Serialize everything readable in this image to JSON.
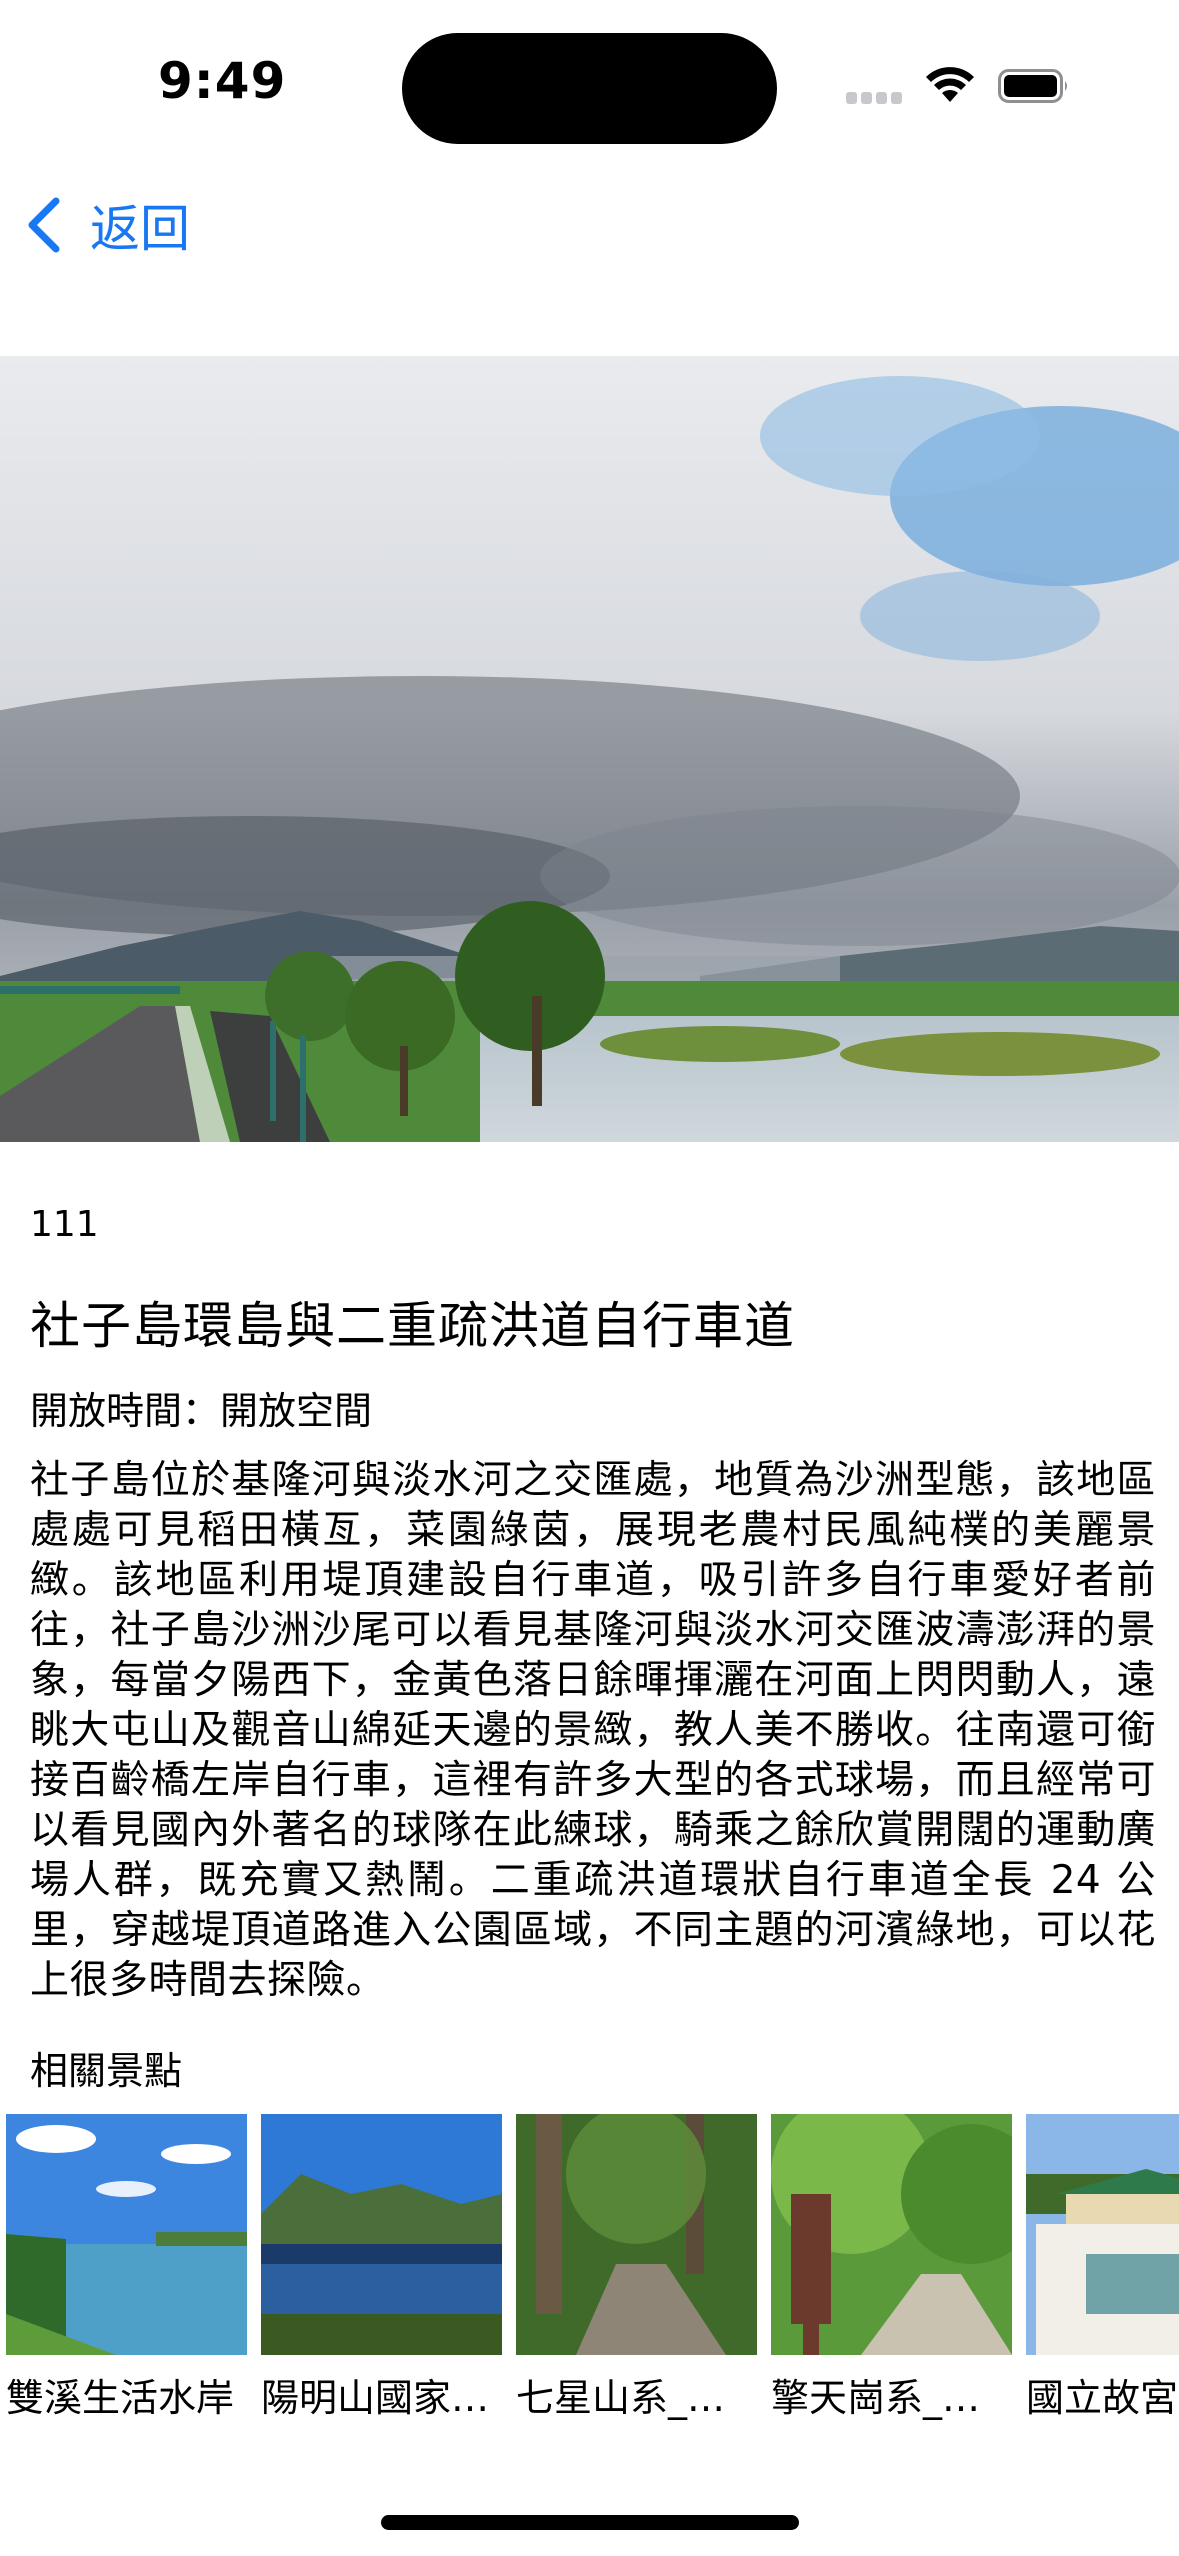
{
  "status_bar": {
    "time": "9:49"
  },
  "nav": {
    "back_label": "返回"
  },
  "attraction": {
    "id": "111",
    "title": "社子島環島與二重疏洪道自行車道",
    "open_time": "開放時間：開放空間",
    "description": "社子島位於基隆河與淡水河之交匯處，地質為沙洲型態，該地區處處可見稻田橫亙，菜園綠茵，展現老農村民風純樸的美麗景緻。該地區利用堤頂建設自行車道，吸引許多自行車愛好者前往，社子島沙洲沙尾可以看見基隆河與淡水河交匯波濤澎湃的景象，每當夕陽西下，金黃色落日餘暉揮灑在河面上閃閃動人，遠眺大屯山及觀音山綿延天邊的景緻，教人美不勝收。往南還可銜接百齡橋左岸自行車，這裡有許多大型的各式球場，而且經常可以看見國內外著名的球隊在此練球，騎乘之餘欣賞開闊的運動廣場人群，既充實又熱鬧。二重疏洪道環狀自行車道全長 24 公里，穿越堤頂道路進入公園區域，不同主題的河濱綠地，可以花上很多時間去探險。"
  },
  "related": {
    "heading": "相關景點",
    "items": [
      {
        "label": "雙溪生活水岸"
      },
      {
        "label": "陽明山國家公園"
      },
      {
        "label": "七星山系_步道"
      },
      {
        "label": "擎天崗系_步道"
      },
      {
        "label": "國立故宮"
      }
    ]
  },
  "colors": {
    "accent": "#1877f2"
  }
}
